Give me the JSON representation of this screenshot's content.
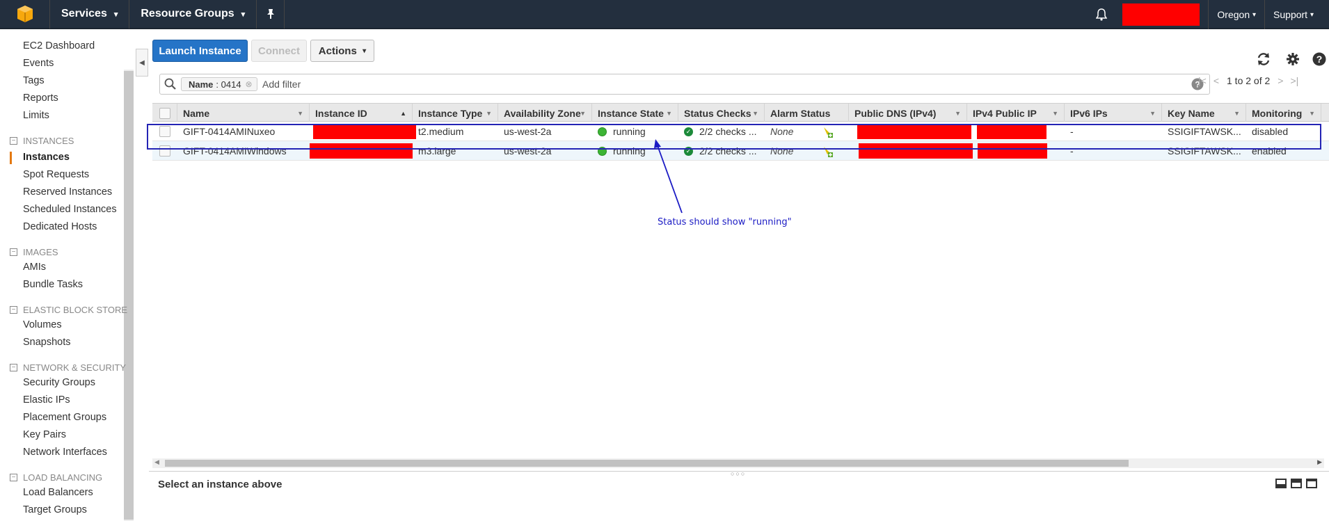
{
  "topbar": {
    "services_label": "Services",
    "resource_groups_label": "Resource Groups",
    "region_label": "Oregon",
    "support_label": "Support"
  },
  "sidebar": {
    "top_links": [
      "EC2 Dashboard",
      "Events",
      "Tags",
      "Reports",
      "Limits"
    ],
    "sections": [
      {
        "title": "INSTANCES",
        "items": [
          "Instances",
          "Spot Requests",
          "Reserved Instances",
          "Scheduled Instances",
          "Dedicated Hosts"
        ]
      },
      {
        "title": "IMAGES",
        "items": [
          "AMIs",
          "Bundle Tasks"
        ]
      },
      {
        "title": "ELASTIC BLOCK STORE",
        "items": [
          "Volumes",
          "Snapshots"
        ]
      },
      {
        "title": "NETWORK & SECURITY",
        "items": [
          "Security Groups",
          "Elastic IPs",
          "Placement Groups",
          "Key Pairs",
          "Network Interfaces"
        ]
      },
      {
        "title": "LOAD BALANCING",
        "items": [
          "Load Balancers",
          "Target Groups"
        ]
      }
    ],
    "active_item": "Instances"
  },
  "toolbar": {
    "launch_label": "Launch Instance",
    "connect_label": "Connect",
    "actions_label": "Actions"
  },
  "filter": {
    "token_key": "Name",
    "token_value": ": 0414",
    "placeholder": "Add filter",
    "pager_text": "1 to 2 of 2"
  },
  "table": {
    "columns": [
      "Name",
      "Instance ID",
      "Instance Type",
      "Availability Zone",
      "Instance State",
      "Status Checks",
      "Alarm Status",
      "Public DNS (IPv4)",
      "IPv4 Public IP",
      "IPv6 IPs",
      "Key Name",
      "Monitoring"
    ],
    "rows": [
      {
        "name": "GIFT-0414AMINuxeo",
        "type": "t2.medium",
        "az": "us-west-2a",
        "state": "running",
        "checks": "2/2 checks ...",
        "alarm": "None",
        "ipv6": "-",
        "key": "SSIGIFTAWSK...",
        "monitoring": "disabled"
      },
      {
        "name": "GIFT-0414AMIWindows",
        "type": "m3.large",
        "az": "us-west-2a",
        "state": "running",
        "checks": "2/2 checks ...",
        "alarm": "None",
        "ipv6": "-",
        "key": "SSIGIFTAWSK...",
        "monitoring": "enabled"
      }
    ]
  },
  "annotation": "Status should show \"running\"",
  "bottom": {
    "select_text": "Select an instance above"
  },
  "colors": {
    "topbar": "#232f3e",
    "primary_button": "#2574c7",
    "running_dot": "#3cb435",
    "annotation": "#1b1bc4",
    "redaction": "#ff0000"
  }
}
